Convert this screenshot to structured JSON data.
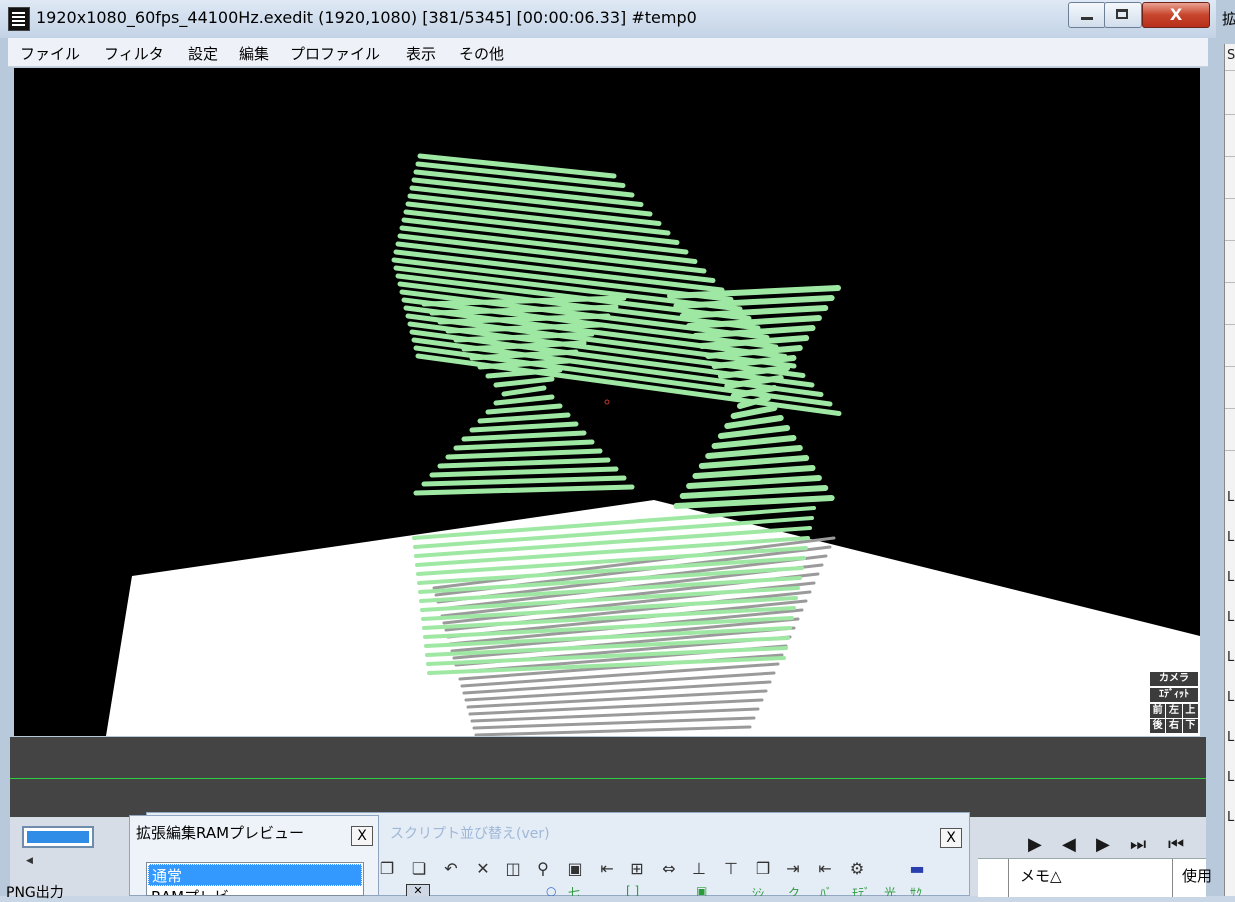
{
  "window": {
    "title": "1920x1080_60fps_44100Hz.exedit (1920,1080)  [381/5345] [00:00:06.33]  #temp0",
    "minimize": "",
    "maximize": "",
    "close": "X"
  },
  "menu": [
    "ファイル",
    "フィルタ",
    "設定",
    "編集",
    "プロファイル",
    "表示",
    "その他"
  ],
  "camera_panel": {
    "camera": "カメラ",
    "edit": "ｴﾃﾞｨｯﾄ",
    "grid": [
      "前",
      "左",
      "上",
      "後",
      "右",
      "下"
    ]
  },
  "colors": {
    "spring": "#9fe8a4",
    "floor": "#ffffff",
    "shadow": "#9a9a9a",
    "timeline_line": "#2ecc40",
    "selection": "#3399ff"
  },
  "bottom": {
    "png_label": "PNG出力",
    "columns": [
      "メモ△",
      "使用"
    ]
  },
  "ram_preview": {
    "title": "拡張編集RAMプレビュー",
    "close": "X",
    "options": [
      "通常",
      "RAMプレビ"
    ]
  },
  "script_dialog": {
    "title": "スクリプト並び替え(ver)",
    "close": "X"
  },
  "right_window": {
    "title": "拡",
    "rows": [
      "S",
      "L",
      "L",
      "L",
      "L",
      "L",
      "L",
      "L",
      "L",
      "L"
    ]
  }
}
